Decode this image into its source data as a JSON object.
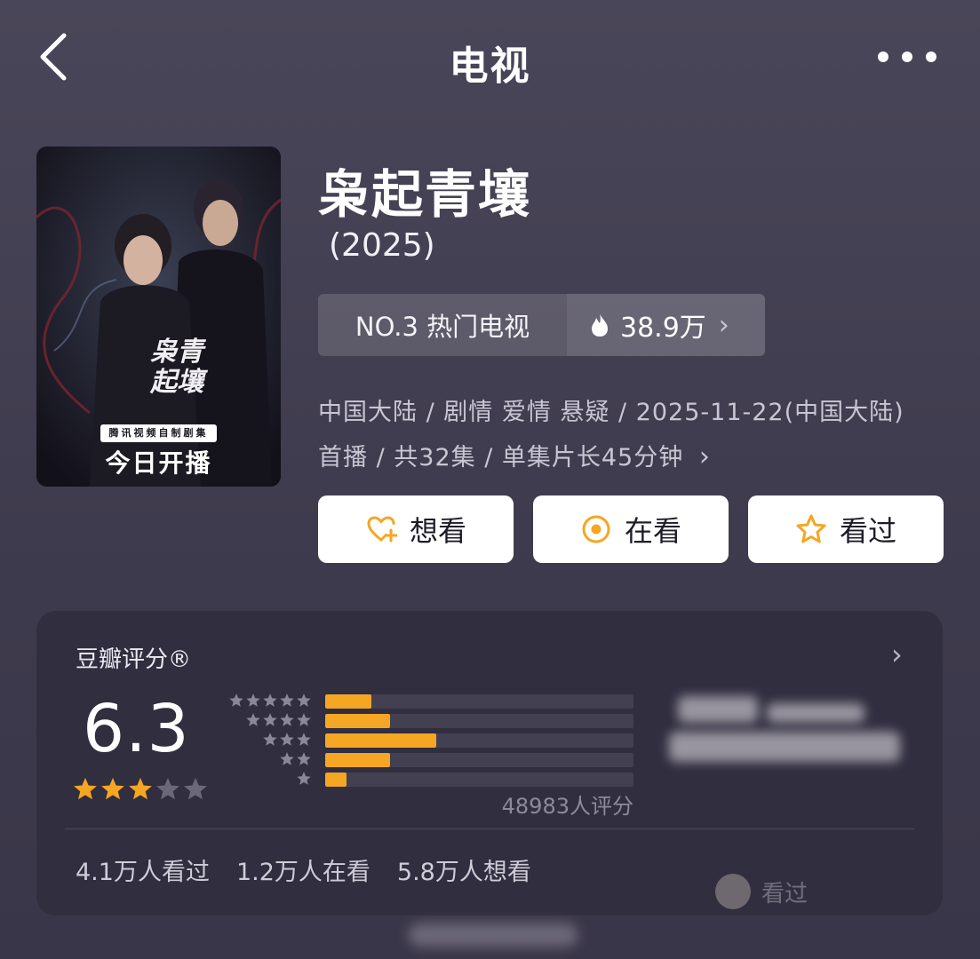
{
  "nav": {
    "title": "电视",
    "back_icon": "chevron-left-icon",
    "more_icon": "more-dots-icon"
  },
  "poster": {
    "calligraphy": "枭青起壤",
    "strap": "腾讯视频自制剧集",
    "stamp": "今日开播"
  },
  "show": {
    "title": "枭起青壤",
    "year": "(2025)",
    "rank_label": "NO.3 热门电视",
    "heat_icon": "flame-icon",
    "heat_value": "38.9万",
    "meta_line1": "中国大陆 / 剧情 爱情 悬疑 / 2025-11-22(中国大陆)",
    "meta_line2": "首播 / 共32集 / 单集片长45分钟"
  },
  "actions": [
    {
      "label": "想看",
      "icon": "heart-plus-icon"
    },
    {
      "label": "在看",
      "icon": "target-circle-icon"
    },
    {
      "label": "看过",
      "icon": "star-outline-icon"
    }
  ],
  "rating": {
    "title": "豆瓣评分®",
    "score": "6.3",
    "star_level": 3,
    "star_max": 5,
    "distribution_percent": [
      15,
      21,
      36,
      21,
      7
    ],
    "rate_count": "48983人评分",
    "stats": [
      "4.1万人看过",
      "1.2万人在看",
      "5.8万人想看"
    ],
    "watched_label": "看过"
  },
  "colors": {
    "accent": "#f5a623",
    "background": "#45415a",
    "card": "#312e3f"
  }
}
